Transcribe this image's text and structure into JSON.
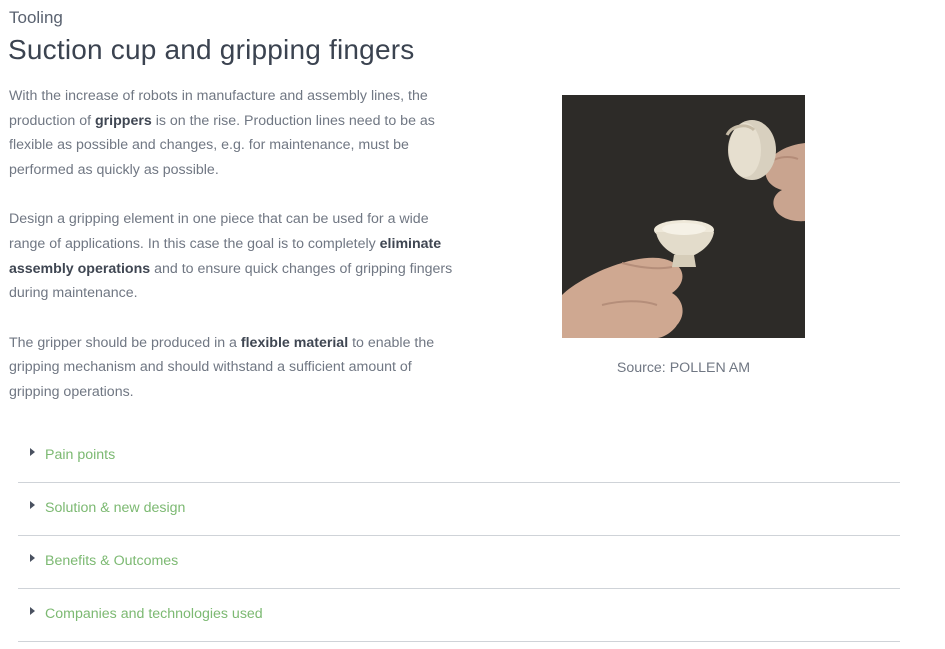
{
  "header": {
    "category": "Tooling",
    "title": "Suction cup and gripping fingers"
  },
  "content": {
    "p1": {
      "a": "With the increase of robots in manufacture and assembly lines, the production of ",
      "b_bold": "grippers",
      "c": " is on the rise. Production lines need to be as flexible as possible and changes, e.g. for maintenance, must be performed as quickly as possible."
    },
    "p2": {
      "a": "Design a gripping element in one piece that can be used for a wide range of applications. In this case the goal is to completely ",
      "b_bold": "eliminate assembly operations",
      "c": " and to ensure quick changes of gripping fingers during maintenance."
    },
    "p3": {
      "a": "The gripper should be produced in a ",
      "b_bold": "flexible material",
      "c": " to enable the gripping mechanism and should withstand a sufficient amount of gripping operations."
    }
  },
  "figure": {
    "caption": "Source: POLLEN AM"
  },
  "accordion": {
    "items": [
      {
        "label": "Pain points"
      },
      {
        "label": "Solution & new design"
      },
      {
        "label": "Benefits & Outcomes"
      },
      {
        "label": "Companies and technologies used"
      }
    ]
  },
  "colors": {
    "accent_green": "#7cb972",
    "title_text": "#3b4350",
    "body_text": "#707783",
    "divider": "#cfd3d8",
    "photo_background": "#2c2a27"
  }
}
